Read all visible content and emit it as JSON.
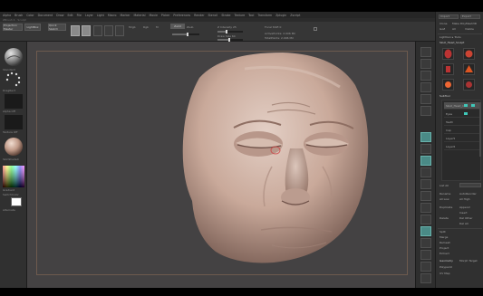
{
  "menu": [
    "Alpha",
    "Brush",
    "Color",
    "Document",
    "Draw",
    "Edit",
    "File",
    "Layer",
    "Light",
    "Macro",
    "Marker",
    "Material",
    "Movie",
    "Picker",
    "Preferences",
    "Render",
    "Stencil",
    "Stroke",
    "Texture",
    "Tool",
    "Transform",
    "Zplugin",
    "Zscript"
  ],
  "title_line": "ZBrush 4 · Sculpt",
  "toolbar": {
    "projection_master": "Projection Master",
    "lightbox": "LightBox",
    "quick_sketch": "Quick Sketch",
    "mrgb": "Mrgb",
    "rgb": "Rgb",
    "m": "M",
    "zadd": "Zadd",
    "zsub": "Zsub",
    "z_intensity": "Z Intensity 25",
    "focal_shift": "Focal Shift 0",
    "draw_size": "Draw Size 64",
    "active_points": "ActivePoints: 2.006 Mil",
    "total_points": "TotalPoints: 2.006 Mil",
    "rgb_intensity_level": 0.55,
    "z_intensity_level": 0.35,
    "draw_size_level": 0.45
  },
  "left_tray": {
    "brush_label": "Standard",
    "stroke_label": "DragRect",
    "alpha_label": "Alpha Off",
    "texture_label": "Texture Off",
    "material_label": "SkinShade4",
    "gradient_label": "Gradient",
    "switch_color": "SwitchColor",
    "alternate": "Alternate",
    "primary_color": "#ffffff"
  },
  "right_tray": {
    "tabs": [
      "Import",
      "Export"
    ],
    "tool_buttons": [
      "Clone",
      "Make PolyMesh3D",
      "GoZ",
      "All",
      "Visible"
    ],
    "lightbox_tools": "Lightbox ▸ Tools",
    "current_tool": "Skull_Head_Sculpt",
    "subtool_header": "SubTool",
    "subtools": [
      "Skull_Head_1",
      "Eyes",
      "Teeth",
      "Cap",
      "Layer5",
      "Layer6"
    ],
    "list_all": "List All",
    "rename": "Rename",
    "autoreorder": "AutoReorder",
    "all_low": "All Low",
    "all_high": "All High",
    "duplicate": "Duplicate",
    "append": "Append",
    "insert": "Insert",
    "delete": "Delete",
    "del_other": "Del Other",
    "del_all": "Del All",
    "split": "Split",
    "merge": "Merge",
    "remesh": "Remesh",
    "project": "Project",
    "extract": "Extract",
    "geometry": "Geometry",
    "morph_target": "Morph Target",
    "polypaint": "Polypaint",
    "uv_map": "UV Map"
  },
  "shelf_icons": [
    "bpr-icon",
    "spix-icon",
    "scroll-icon",
    "zoom-icon",
    "actual-icon",
    "aahalf-icon",
    "persp-icon",
    "floor-icon",
    "local-icon",
    "lsym-icon",
    "xyz-icon",
    "frame-icon",
    "move-icon",
    "scale-icon",
    "rotate-icon",
    "polyf-icon",
    "transp-icon",
    "ghost-icon",
    "solo-icon",
    "xpose-icon"
  ],
  "colors": {
    "viewport_bg": "#444243",
    "ui_bg": "#2b2b2b",
    "accent_teal": "#3fc7b8",
    "canvas_border": "#6e5a4e",
    "skin": "#c9a99a"
  }
}
